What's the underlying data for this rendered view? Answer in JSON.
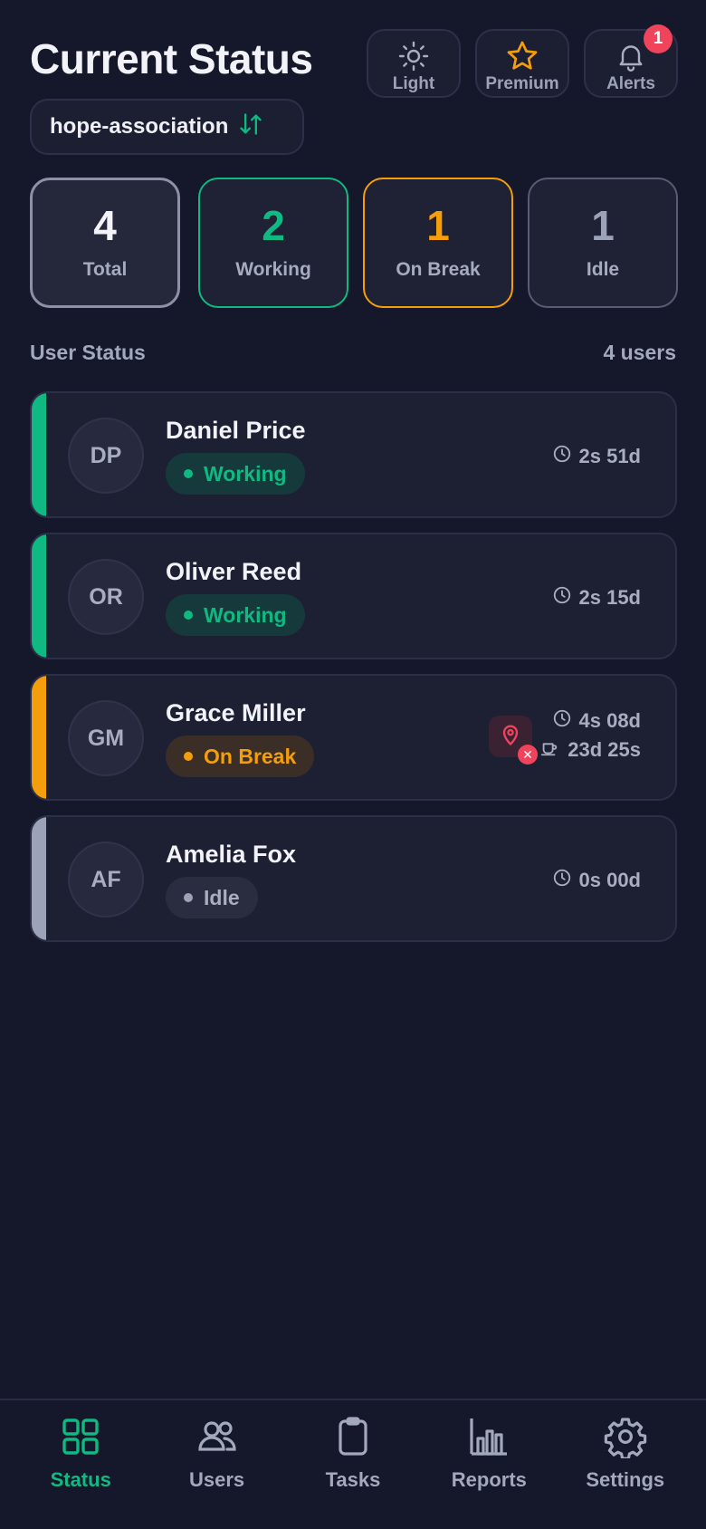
{
  "header": {
    "title": "Current Status",
    "buttons": {
      "light_label": "Light",
      "premium_label": "Premium",
      "alerts_label": "Alerts",
      "alerts_badge": "1"
    },
    "org_name": "hope-association"
  },
  "stats": {
    "total": {
      "value": "4",
      "label": "Total"
    },
    "working": {
      "value": "2",
      "label": "Working"
    },
    "on_break": {
      "value": "1",
      "label": "On Break"
    },
    "idle": {
      "value": "1",
      "label": "Idle"
    }
  },
  "section": {
    "title": "User Status",
    "count": "4 users"
  },
  "users": [
    {
      "initials": "DP",
      "name": "Daniel Price",
      "status": "Working",
      "time": "2s 51d"
    },
    {
      "initials": "OR",
      "name": "Oliver Reed",
      "status": "Working",
      "time": "2s 15d"
    },
    {
      "initials": "GM",
      "name": "Grace Miller",
      "status": "On Break",
      "time": "4s 08d",
      "break_time": "23d 25s"
    },
    {
      "initials": "AF",
      "name": "Amelia Fox",
      "status": "Idle",
      "time": "0s 00d"
    }
  ],
  "tabs": [
    {
      "label": "Status",
      "icon": "grid-icon"
    },
    {
      "label": "Users",
      "icon": "users-icon"
    },
    {
      "label": "Tasks",
      "icon": "clipboard-icon"
    },
    {
      "label": "Reports",
      "icon": "bar-chart-icon"
    },
    {
      "label": "Settings",
      "icon": "gear-icon"
    }
  ],
  "colors": {
    "background": "#15172a",
    "working": "#10b981",
    "on_break": "#f59e0b",
    "idle": "#9ca3b8",
    "alert": "#f0435c"
  }
}
